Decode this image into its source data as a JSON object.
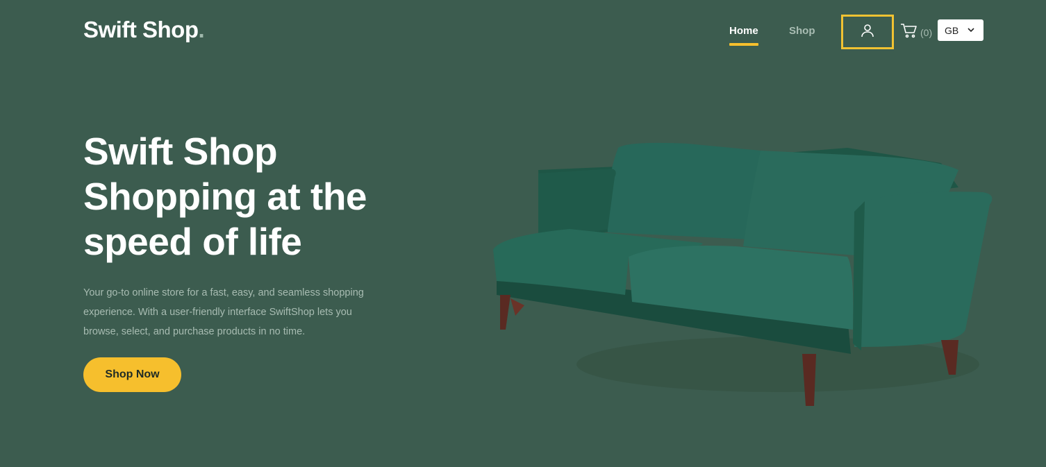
{
  "header": {
    "logo": "Swift Shop",
    "logo_dot": ".",
    "nav": {
      "home": "Home",
      "shop": "Shop"
    },
    "cart_count": "(0)",
    "language": "GB"
  },
  "icons": [
    "user-icon",
    "cart-icon",
    "chevron-down-icon"
  ],
  "hero": {
    "title_lines": [
      "Swift Shop",
      "Shopping at the",
      "speed of life"
    ],
    "description": "Your go-to online store for a fast, easy, and seamless shopping experience. With a user-friendly interface SwiftShop lets you browse, select, and purchase products in no time.",
    "cta": "Shop Now"
  },
  "colors": {
    "background": "#3c5c4f",
    "accent": "#f6bf2d",
    "muted_text": "#a8bcb2",
    "sofa": "#1f5b4a"
  }
}
